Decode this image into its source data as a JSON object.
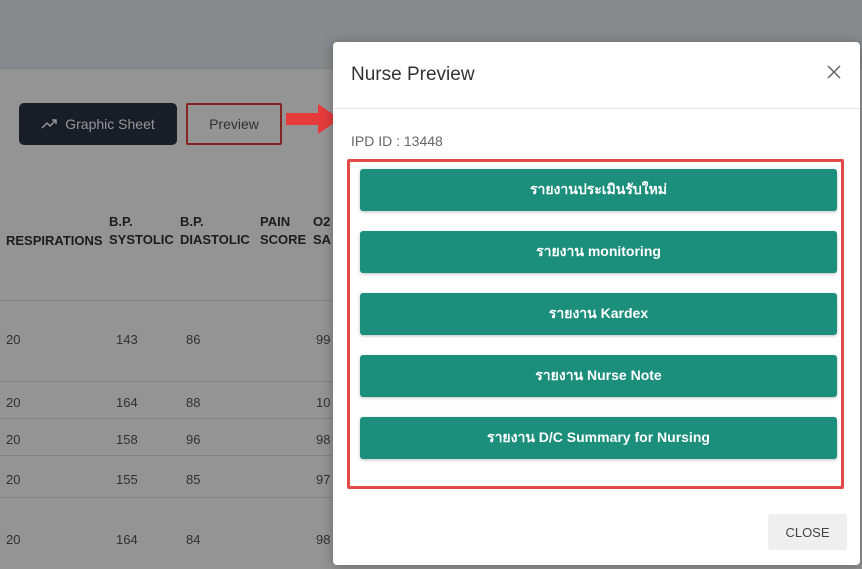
{
  "toolbar": {
    "graphic_sheet_label": "Graphic Sheet",
    "preview_label": "Preview"
  },
  "table": {
    "headers": [
      {
        "line1": "RESPIRATIONS",
        "line2": ""
      },
      {
        "line1": "B.P.",
        "line2": "SYSTOLIC"
      },
      {
        "line1": "B.P.",
        "line2": "DIASTOLIC"
      },
      {
        "line1": "PAIN",
        "line2": "SCORE"
      },
      {
        "line1": "O2",
        "line2": "SA"
      }
    ],
    "rows": [
      [
        "20",
        "143",
        "86",
        "99"
      ],
      [
        "20",
        "164",
        "88",
        "10"
      ],
      [
        "20",
        "158",
        "96",
        "98"
      ],
      [
        "20",
        "155",
        "85",
        "97"
      ],
      [
        "20",
        "164",
        "84",
        "98"
      ]
    ]
  },
  "modal": {
    "title": "Nurse Preview",
    "ipd_id": "IPD ID : 13448",
    "reports": [
      "รายงานประเมินรับใหม่",
      "รายงาน monitoring",
      "รายงาน Kardex",
      "รายงาน Nurse Note",
      "รายงาน D/C Summary for Nursing"
    ],
    "close_label": "CLOSE"
  },
  "colors": {
    "report_button": "#1b8e7c",
    "highlight": "#e24a4a",
    "dark_button": "#2b3346"
  },
  "icons": {
    "graphic_sheet": "trending-up-icon",
    "close": "close-icon",
    "annotation": "arrow-right-icon"
  }
}
